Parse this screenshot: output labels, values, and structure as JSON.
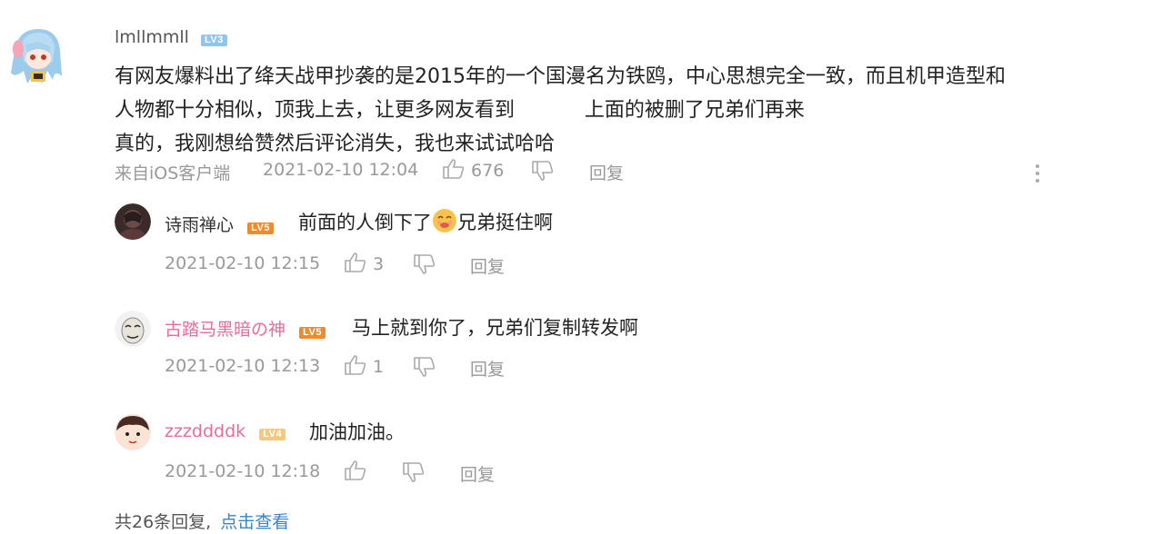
{
  "comment": {
    "username": "lmllmmll",
    "level": "LV3",
    "lines": [
      "有网友爆料出了绛天战甲抄袭的是2015年的一个国漫名为铁鸥，中心思想完全一致，而且机甲造型和",
      "人物都十分相似，顶我上去，让更多网友看到           上面的被删了兄弟们再来",
      "真的，我刚想给赞然后评论消失，我也来试试哈哈"
    ],
    "source": "来自iOS客户端",
    "time": "2021-02-10 12:04",
    "likes": "676",
    "reply_label": "回复"
  },
  "replies": [
    {
      "username": "诗雨禅心",
      "level": "LV5",
      "text_before": "前面的人倒下了",
      "emoji": "😌",
      "text_after": "兄弟挺住啊",
      "time": "2021-02-10 12:15",
      "likes": "3",
      "reply_label": "回复",
      "name_color": "#333333"
    },
    {
      "username": "古踏马黑暗の神",
      "level": "LV5",
      "text": "马上就到你了，兄弟们复制转发啊",
      "time": "2021-02-10 12:13",
      "likes": "1",
      "reply_label": "回复",
      "name_color": "#e56c9c"
    },
    {
      "username": "zzzddddk",
      "level": "LV4",
      "text": "加油加油。",
      "time": "2021-02-10 12:18",
      "likes": "",
      "reply_label": "回复",
      "name_color": "#e56c9c"
    }
  ],
  "footer": {
    "total_text": "共26条回复,",
    "link_text": "点击查看"
  }
}
